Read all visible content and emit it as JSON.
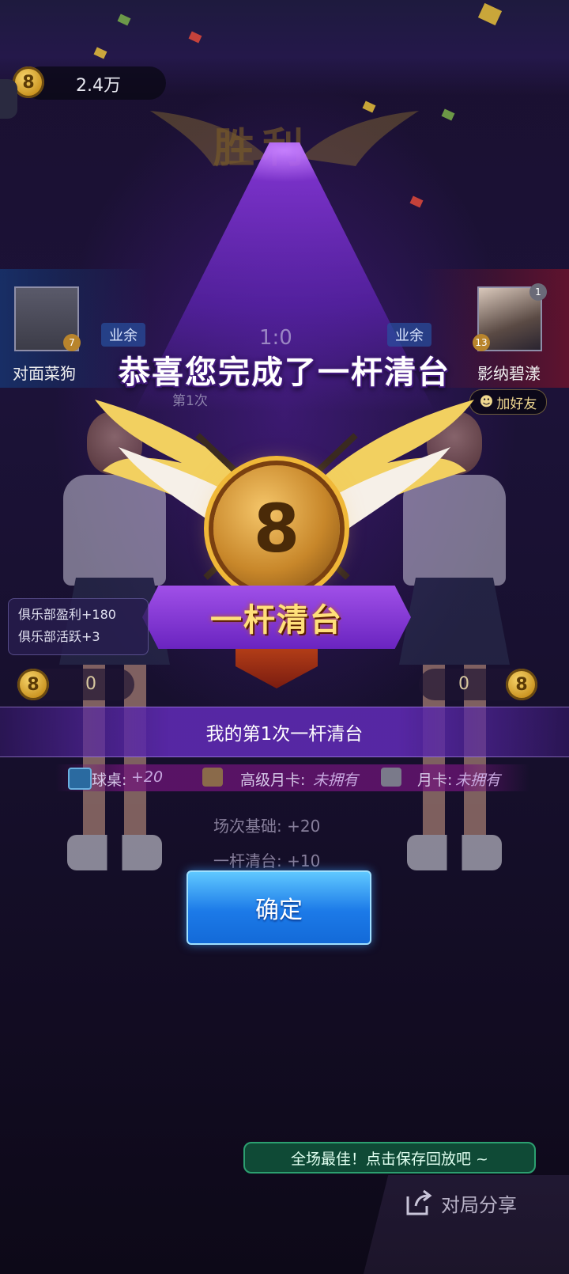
{
  "colors": {
    "accent_purple": "#7a3ae0",
    "gold": "#f0b838",
    "confirm_blue": "#1c7ae8",
    "save_tip_green": "#0f4a36"
  },
  "top": {
    "coin_icon_label": "8",
    "coin_amount": "2.4万",
    "victory_title": "胜利"
  },
  "match": {
    "left_player": {
      "name": "对面菜狗",
      "level": "7",
      "rank": "业余",
      "icon": "default-avatar-icon"
    },
    "right_player": {
      "name": "影纳碧漾",
      "level": "13",
      "rank": "业余",
      "icon": "player-avatar-icon",
      "corner_badge": "1"
    },
    "score": "1:0",
    "round_label": "第1次",
    "add_friend": "加好友"
  },
  "congrats_text": "恭喜您完成了一杆清台",
  "badge": {
    "ball_number": "8",
    "ribbon_text": "一杆清台"
  },
  "club": {
    "profit": "俱乐部盈利+180",
    "activity": "俱乐部活跃+3"
  },
  "pots": {
    "left_value": "0",
    "right_value": "0",
    "coin_label": "8"
  },
  "result_banner": "我的第1次一杆清台",
  "bonuses": {
    "table_label": "球桌:",
    "table_value": "+20",
    "premium_label": "高级月卡:",
    "premium_value": "未拥有",
    "monthly_label": "月卡:",
    "monthly_value": "未拥有"
  },
  "details": {
    "base_label": "场次基础:",
    "base_value": "+20",
    "clear_label": "一杆清台:",
    "clear_value": "+10"
  },
  "confirm_button": "确定",
  "save_tip": "全场最佳！点击保存回放吧 ~",
  "share_button": "对局分享"
}
